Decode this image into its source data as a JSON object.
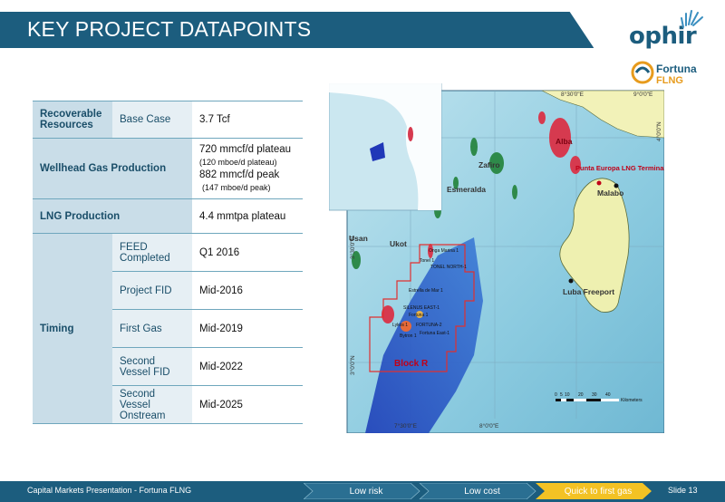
{
  "header": {
    "title": "KEY PROJECT DATAPOINTS"
  },
  "logos": {
    "ophir": "ophir",
    "fortuna": "Fortuna",
    "flng": "FLNG"
  },
  "table": {
    "rows": [
      {
        "label": "Recoverable Resources",
        "sub": "Base Case",
        "value": "3.7 Tcf"
      },
      {
        "label": "Wellhead Gas Production",
        "lines": [
          "720 mmcf/d plateau",
          "(120 mboe/d plateau)",
          "882 mmcf/d peak",
          "(147 mboe/d peak)"
        ]
      },
      {
        "label": "LNG Production",
        "value": "4.4 mmtpa plateau"
      },
      {
        "label": "Timing",
        "items": [
          {
            "sub": "FEED Completed",
            "value": "Q1 2016"
          },
          {
            "sub": "Project FID",
            "value": "Mid-2016"
          },
          {
            "sub": "First Gas",
            "value": "Mid-2019"
          },
          {
            "sub": "Second Vessel FID",
            "value": "Mid-2022"
          },
          {
            "sub": "Second Vessel Onstream",
            "value": "Mid-2025"
          }
        ]
      }
    ]
  },
  "map": {
    "places": [
      "Alba",
      "Punta Europa LNG Terminal",
      "Malabo",
      "Zafiro",
      "Esmeralda",
      "Usan",
      "Ukot",
      "Luba Freeport",
      "Block R"
    ],
    "wells": [
      "Onga Marina 1",
      "Tonel 1",
      "TONEL NORTH-1",
      "Estrella de Mar 1",
      "SILENUS EAST-1",
      "Fortuna 1",
      "Lykos 1",
      "FORTUNA-2",
      "Fortuna East-1",
      "Bytron 1"
    ],
    "lon_ticks": [
      "7°30'0\"E",
      "8°0'0\"E",
      "8°30'0\"E",
      "9°0'0\"E"
    ],
    "lat_ticks": [
      "4°0'0\"N",
      "3°30'0\"N",
      "3°0'0\"N"
    ],
    "scale": {
      "ticks": [
        "0",
        "5",
        "10",
        "20",
        "30",
        "40"
      ],
      "unit": "Kilometers"
    }
  },
  "footer": {
    "text": "Capital Markets Presentation - Fortuna FLNG",
    "steps": [
      "Low risk",
      "Low cost",
      "Quick to first gas"
    ],
    "slide": "Slide 13"
  }
}
